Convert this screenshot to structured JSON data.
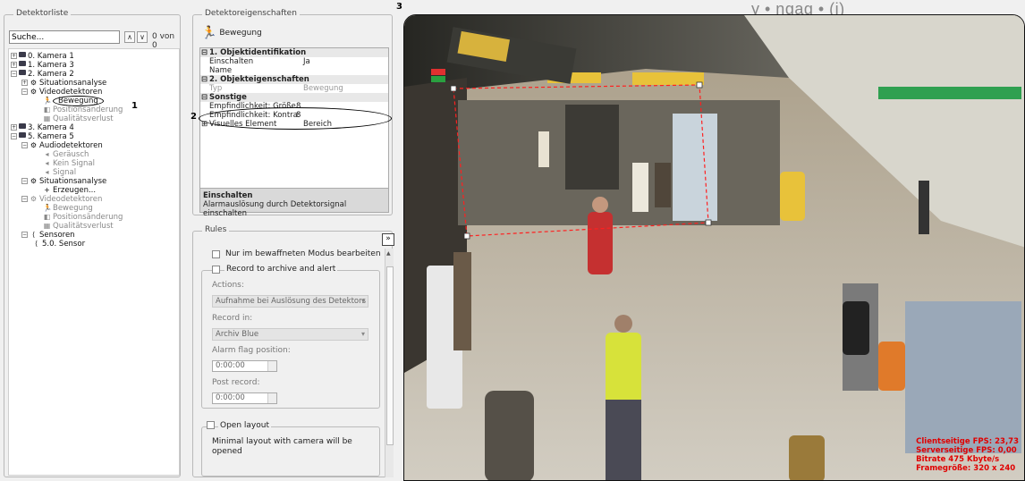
{
  "detector_list": {
    "title": "Detektorliste",
    "search_placeholder": "Suche...",
    "search_count": "0 von 0",
    "tree": [
      {
        "label": "0. Kamera 1",
        "box": "+"
      },
      {
        "label": "1. Kamera 3",
        "box": "+"
      },
      {
        "label": "2. Kamera 2",
        "box": "−"
      },
      {
        "label": "Situationsanalyse",
        "box": "+"
      },
      {
        "label": "Videodetektoren",
        "box": "−"
      },
      {
        "label": "Bewegung"
      },
      {
        "label": "Positionsänderung"
      },
      {
        "label": "Qualitätsverlust"
      },
      {
        "label": "3. Kamera 4",
        "box": "+"
      },
      {
        "label": "5. Kamera 5",
        "box": "−"
      },
      {
        "label": "Audiodetektoren",
        "box": "−"
      },
      {
        "label": "Geräusch"
      },
      {
        "label": "Kein Signal"
      },
      {
        "label": "Signal"
      },
      {
        "label": "Situationsanalyse",
        "box": "−"
      },
      {
        "label": "Erzeugen..."
      },
      {
        "label": "Videodetektoren",
        "box": "−"
      },
      {
        "label": "Bewegung"
      },
      {
        "label": "Positionsänderung"
      },
      {
        "label": "Qualitätsverlust"
      },
      {
        "label": "Sensoren",
        "box": "−"
      },
      {
        "label": "5.0. Sensor"
      }
    ]
  },
  "detector_properties": {
    "title": "Detektoreigenschaften",
    "header_label": "Bewegung",
    "sections": {
      "identification": "1. Objektidentifikation",
      "properties": "2. Objekteigenschaften",
      "other": "Sonstige"
    },
    "rows": {
      "einschalten_key": "Einschalten",
      "einschalten_val": "Ja",
      "name_key": "Name",
      "name_val": "",
      "typ_key": "Typ",
      "typ_val": "Bewegung",
      "size_key": "Empfindlichkeit: Größe",
      "size_val": "8",
      "contrast_key": "Empfindlichkeit: Kontrast",
      "contrast_val": "8",
      "visual_key": "Visuelles Element",
      "visual_val": "Bereich"
    },
    "description_title": "Einschalten",
    "description_text": "Alarmauslösung durch Detektorsignal einschalten"
  },
  "rules": {
    "title": "Rules",
    "armed_only": "Nur im bewaffneten Modus bearbeiten",
    "record_alert": "Record to archive and alert",
    "actions_label": "Actions:",
    "actions_value": "Aufnahme bei Auslösung des Detektors",
    "record_in_label": "Record in:",
    "record_in_value": "Archiv Blue",
    "alarm_flag_label": "Alarm flag position:",
    "alarm_flag_value": "0:00:00",
    "post_record_label": "Post record:",
    "post_record_value": "0:00:00",
    "open_layout": "Open layout",
    "open_layout_desc": "Minimal layout with camera will be opened",
    "expand_label": "»"
  },
  "camera": {
    "partial_title": "y • ngag • (i)",
    "stats": [
      "Clientseitige FPS: 23,73",
      "Serverseitige FPS: 0,00",
      "Bitrate 475 Kbyte/s",
      "Framegröße: 320 x 240"
    ]
  },
  "callouts": {
    "one": "1",
    "two": "2",
    "three": "3"
  },
  "colors": {
    "detection_zone": "#ff2020",
    "stats_text": "#e00000"
  }
}
